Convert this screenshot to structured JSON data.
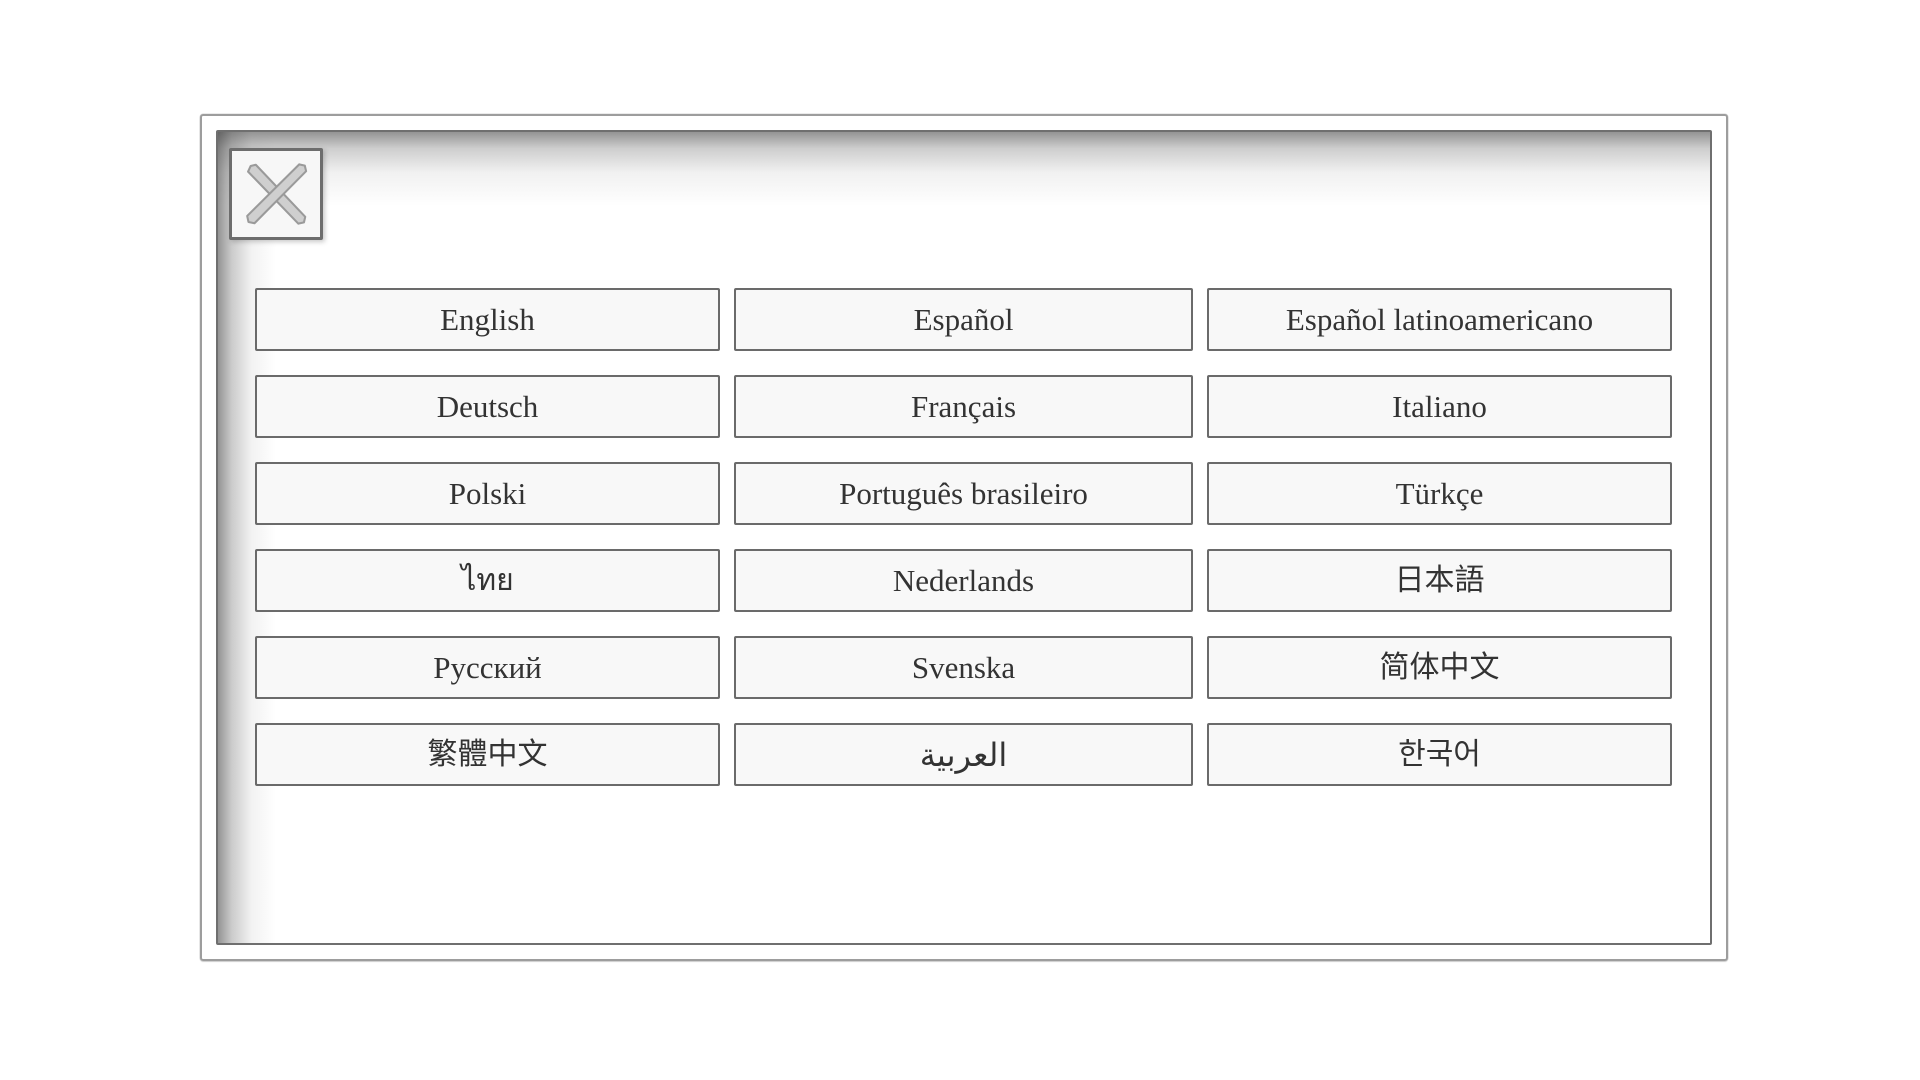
{
  "window": {
    "close_button": {
      "name": "close-button",
      "icon": "close-x-icon"
    }
  },
  "language_select": {
    "columns": 3,
    "rows": 6,
    "buttons": [
      {
        "label": "English",
        "script": "latin"
      },
      {
        "label": "Español",
        "script": "latin"
      },
      {
        "label": "Español latinoamericano",
        "script": "latin"
      },
      {
        "label": "Deutsch",
        "script": "latin"
      },
      {
        "label": "Français",
        "script": "latin"
      },
      {
        "label": "Italiano",
        "script": "latin"
      },
      {
        "label": "Polski",
        "script": "latin"
      },
      {
        "label": "Português brasileiro",
        "script": "latin"
      },
      {
        "label": "Türkçe",
        "script": "latin"
      },
      {
        "label": "ไทย",
        "script": "thai"
      },
      {
        "label": "Nederlands",
        "script": "latin"
      },
      {
        "label": "日本語",
        "script": "cjk"
      },
      {
        "label": "Русский",
        "script": "latin"
      },
      {
        "label": "Svenska",
        "script": "latin"
      },
      {
        "label": "简体中文",
        "script": "cjk"
      },
      {
        "label": "繁體中文",
        "script": "cjk"
      },
      {
        "label": "العربية",
        "script": "arabic"
      },
      {
        "label": "한국어",
        "script": "cjk"
      }
    ]
  },
  "colors": {
    "page_background": "#ffffff",
    "window_background": "#ffffff",
    "frame_stroke": "#6f6f6f",
    "button_background": "#f8f8f8",
    "button_stroke": "#6a6a6a",
    "text": "#333333",
    "close_icon_fill": "#c9c9c9",
    "close_icon_stroke": "#8f8f8f"
  }
}
